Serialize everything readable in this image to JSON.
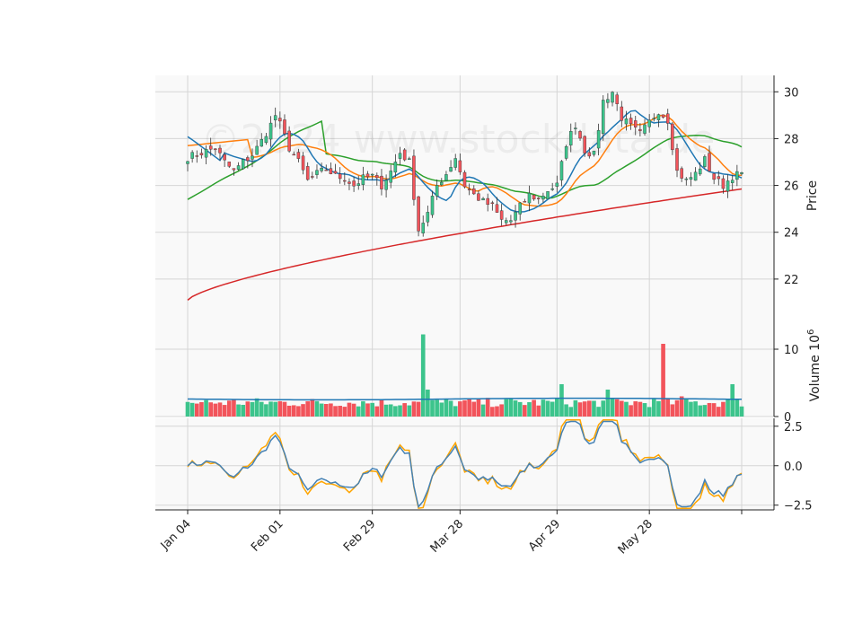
{
  "watermark": "©2024 www.stockdata.de",
  "chart_data": {
    "type": "candlestick",
    "panels": [
      {
        "name": "price",
        "ylabel": "Price",
        "yticks": [
          22,
          24,
          26,
          28,
          30
        ],
        "ylim": [
          20.5,
          30.7
        ]
      },
      {
        "name": "volume",
        "ylabel": "Volume",
        "ylabel_exponent": "10",
        "ylabel_exponent_power": "6",
        "yticks": [
          0,
          10
        ],
        "ylim": [
          0,
          15.2
        ]
      },
      {
        "name": "oscillator",
        "ylabel": "",
        "ytick_labels": [
          "2.5",
          "0.0",
          "−2.5"
        ],
        "yticks": [
          2.5,
          0,
          -2.5
        ],
        "ylim": [
          -2.8,
          3.0
        ]
      }
    ],
    "x_tick_labels": [
      "Jan 04",
      "Feb 01",
      "Feb 29",
      "Mar 28",
      "Apr 29",
      "May 28",
      ""
    ],
    "x_tick_index": [
      0,
      20,
      40,
      59,
      80,
      100,
      120
    ],
    "n_bars": 120,
    "grid": true,
    "colors": {
      "up": "#3cc48c",
      "down": "#f2545b",
      "background": "#f9f9f9",
      "grid": "#d5d5d5",
      "ma_fast": "#1f77b4",
      "ma_mid": "#ff7f0e",
      "ma_slow": "#2ca02c",
      "ma_long": "#d62728",
      "vol_ma": "#1f77b4",
      "osc_a": "#4682b4",
      "osc_b": "#ffa500"
    },
    "close_anchors": [
      [
        0,
        27.2
      ],
      [
        3,
        27.4
      ],
      [
        6,
        27.6
      ],
      [
        8,
        27.0
      ],
      [
        10,
        26.6
      ],
      [
        12,
        27.0
      ],
      [
        14,
        27.3
      ],
      [
        16,
        27.9
      ],
      [
        18,
        28.6
      ],
      [
        19,
        29.0
      ],
      [
        20,
        28.6
      ],
      [
        22,
        27.6
      ],
      [
        24,
        27.0
      ],
      [
        26,
        26.2
      ],
      [
        28,
        26.5
      ],
      [
        30,
        26.7
      ],
      [
        32,
        26.4
      ],
      [
        34,
        26.3
      ],
      [
        36,
        26.0
      ],
      [
        38,
        26.3
      ],
      [
        40,
        26.4
      ],
      [
        42,
        26.0
      ],
      [
        44,
        26.6
      ],
      [
        46,
        27.4
      ],
      [
        48,
        27.0
      ],
      [
        50,
        24.1
      ],
      [
        52,
        24.8
      ],
      [
        54,
        26.0
      ],
      [
        56,
        26.5
      ],
      [
        58,
        27.2
      ],
      [
        60,
        26.0
      ],
      [
        62,
        25.6
      ],
      [
        64,
        25.3
      ],
      [
        66,
        25.1
      ],
      [
        68,
        24.5
      ],
      [
        70,
        24.5
      ],
      [
        72,
        25.1
      ],
      [
        74,
        25.6
      ],
      [
        76,
        25.4
      ],
      [
        78,
        25.8
      ],
      [
        80,
        26.0
      ],
      [
        82,
        27.8
      ],
      [
        84,
        28.6
      ],
      [
        86,
        27.5
      ],
      [
        88,
        27.3
      ],
      [
        90,
        29.6
      ],
      [
        92,
        30.0
      ],
      [
        94,
        28.9
      ],
      [
        96,
        28.5
      ],
      [
        98,
        28.2
      ],
      [
        100,
        28.7
      ],
      [
        102,
        29.2
      ],
      [
        104,
        28.8
      ],
      [
        106,
        26.6
      ],
      [
        108,
        26.2
      ],
      [
        110,
        26.5
      ],
      [
        112,
        27.1
      ],
      [
        114,
        26.3
      ],
      [
        116,
        26.0
      ],
      [
        118,
        26.4
      ],
      [
        120,
        26.5
      ]
    ],
    "volume_spikes": [
      [
        51,
        12.2
      ],
      [
        52,
        4.0
      ],
      [
        81,
        4.8
      ],
      [
        91,
        4.0
      ],
      [
        103,
        10.8
      ],
      [
        107,
        3.0
      ],
      [
        118,
        4.8
      ]
    ],
    "volume_base": 1.8
  }
}
